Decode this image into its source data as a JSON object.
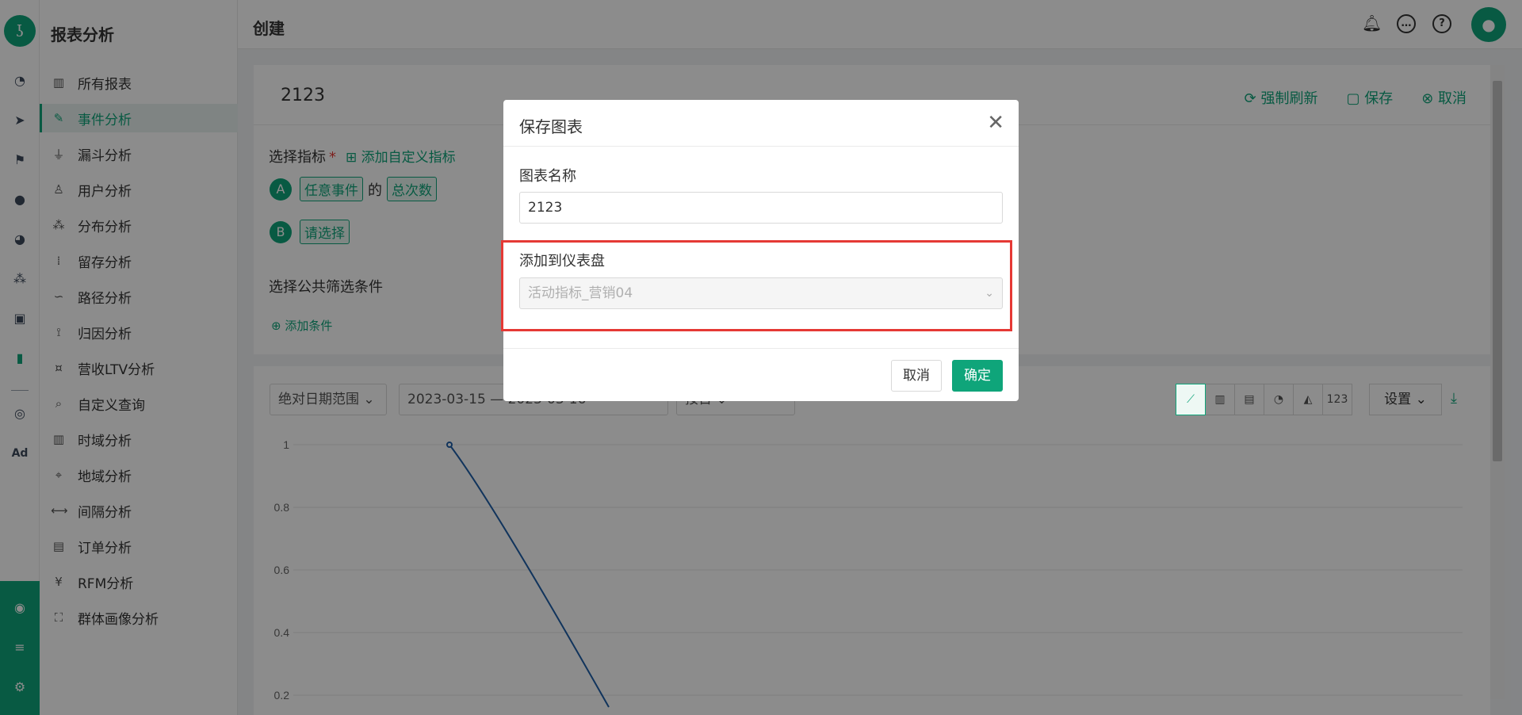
{
  "sidebar": {
    "title": "报表分析",
    "items": [
      {
        "label": "所有报表",
        "icon": "bar-chart-icon"
      },
      {
        "label": "事件分析",
        "icon": "edit-icon",
        "active": true
      },
      {
        "label": "漏斗分析",
        "icon": "funnel-icon"
      },
      {
        "label": "用户分析",
        "icon": "user-icon"
      },
      {
        "label": "分布分析",
        "icon": "distribution-icon"
      },
      {
        "label": "留存分析",
        "icon": "dots-icon"
      },
      {
        "label": "路径分析",
        "icon": "path-icon"
      },
      {
        "label": "归因分析",
        "icon": "attribution-icon"
      },
      {
        "label": "营收LTV分析",
        "icon": "revenue-icon"
      },
      {
        "label": "自定义查询",
        "icon": "query-icon"
      },
      {
        "label": "时域分析",
        "icon": "time-chart-icon"
      },
      {
        "label": "地域分析",
        "icon": "location-icon"
      },
      {
        "label": "间隔分析",
        "icon": "interval-icon"
      },
      {
        "label": "订单分析",
        "icon": "clipboard-icon"
      },
      {
        "label": "RFM分析",
        "icon": "yen-icon"
      },
      {
        "label": "群体画像分析",
        "icon": "portrait-icon"
      }
    ]
  },
  "header": {
    "title": "创建"
  },
  "report": {
    "name": "2123",
    "actions": {
      "refresh": "强制刷新",
      "save": "保存",
      "cancel": "取消"
    },
    "metrics_label": "选择指标",
    "add_custom_metric": "添加自定义指标",
    "metric_a": {
      "badge": "A",
      "event": "任意事件",
      "connector": "的",
      "measure": "总次数"
    },
    "metric_b": {
      "badge": "B",
      "placeholder": "请选择"
    },
    "filter_title": "选择公共筛选条件",
    "add_condition": "添加条件"
  },
  "chart_controls": {
    "date_range_type": "绝对日期范围",
    "start_date": "2023-03-15",
    "end_date": "2023-03-16",
    "granularity": "按日",
    "settings": "设置",
    "type_buttons": [
      "line",
      "bar",
      "stacked-bar",
      "pie",
      "area",
      "123"
    ]
  },
  "chart_data": {
    "type": "line",
    "ylim": [
      0,
      1
    ],
    "yticks": [
      "1",
      "0.8",
      "0.6",
      "0.4",
      "0.2"
    ],
    "series": [
      {
        "values": [
          1,
          0.76,
          0.2
        ]
      }
    ],
    "color": "#1f5fa8"
  },
  "modal": {
    "title": "保存图表",
    "name_label": "图表名称",
    "name_value": "2123",
    "dashboard_label": "添加到仪表盘",
    "dashboard_value": "活动指标_营销04",
    "cancel": "取消",
    "confirm": "确定"
  },
  "colors": {
    "brand": "#0fa57a",
    "highlight": "#e53935"
  }
}
